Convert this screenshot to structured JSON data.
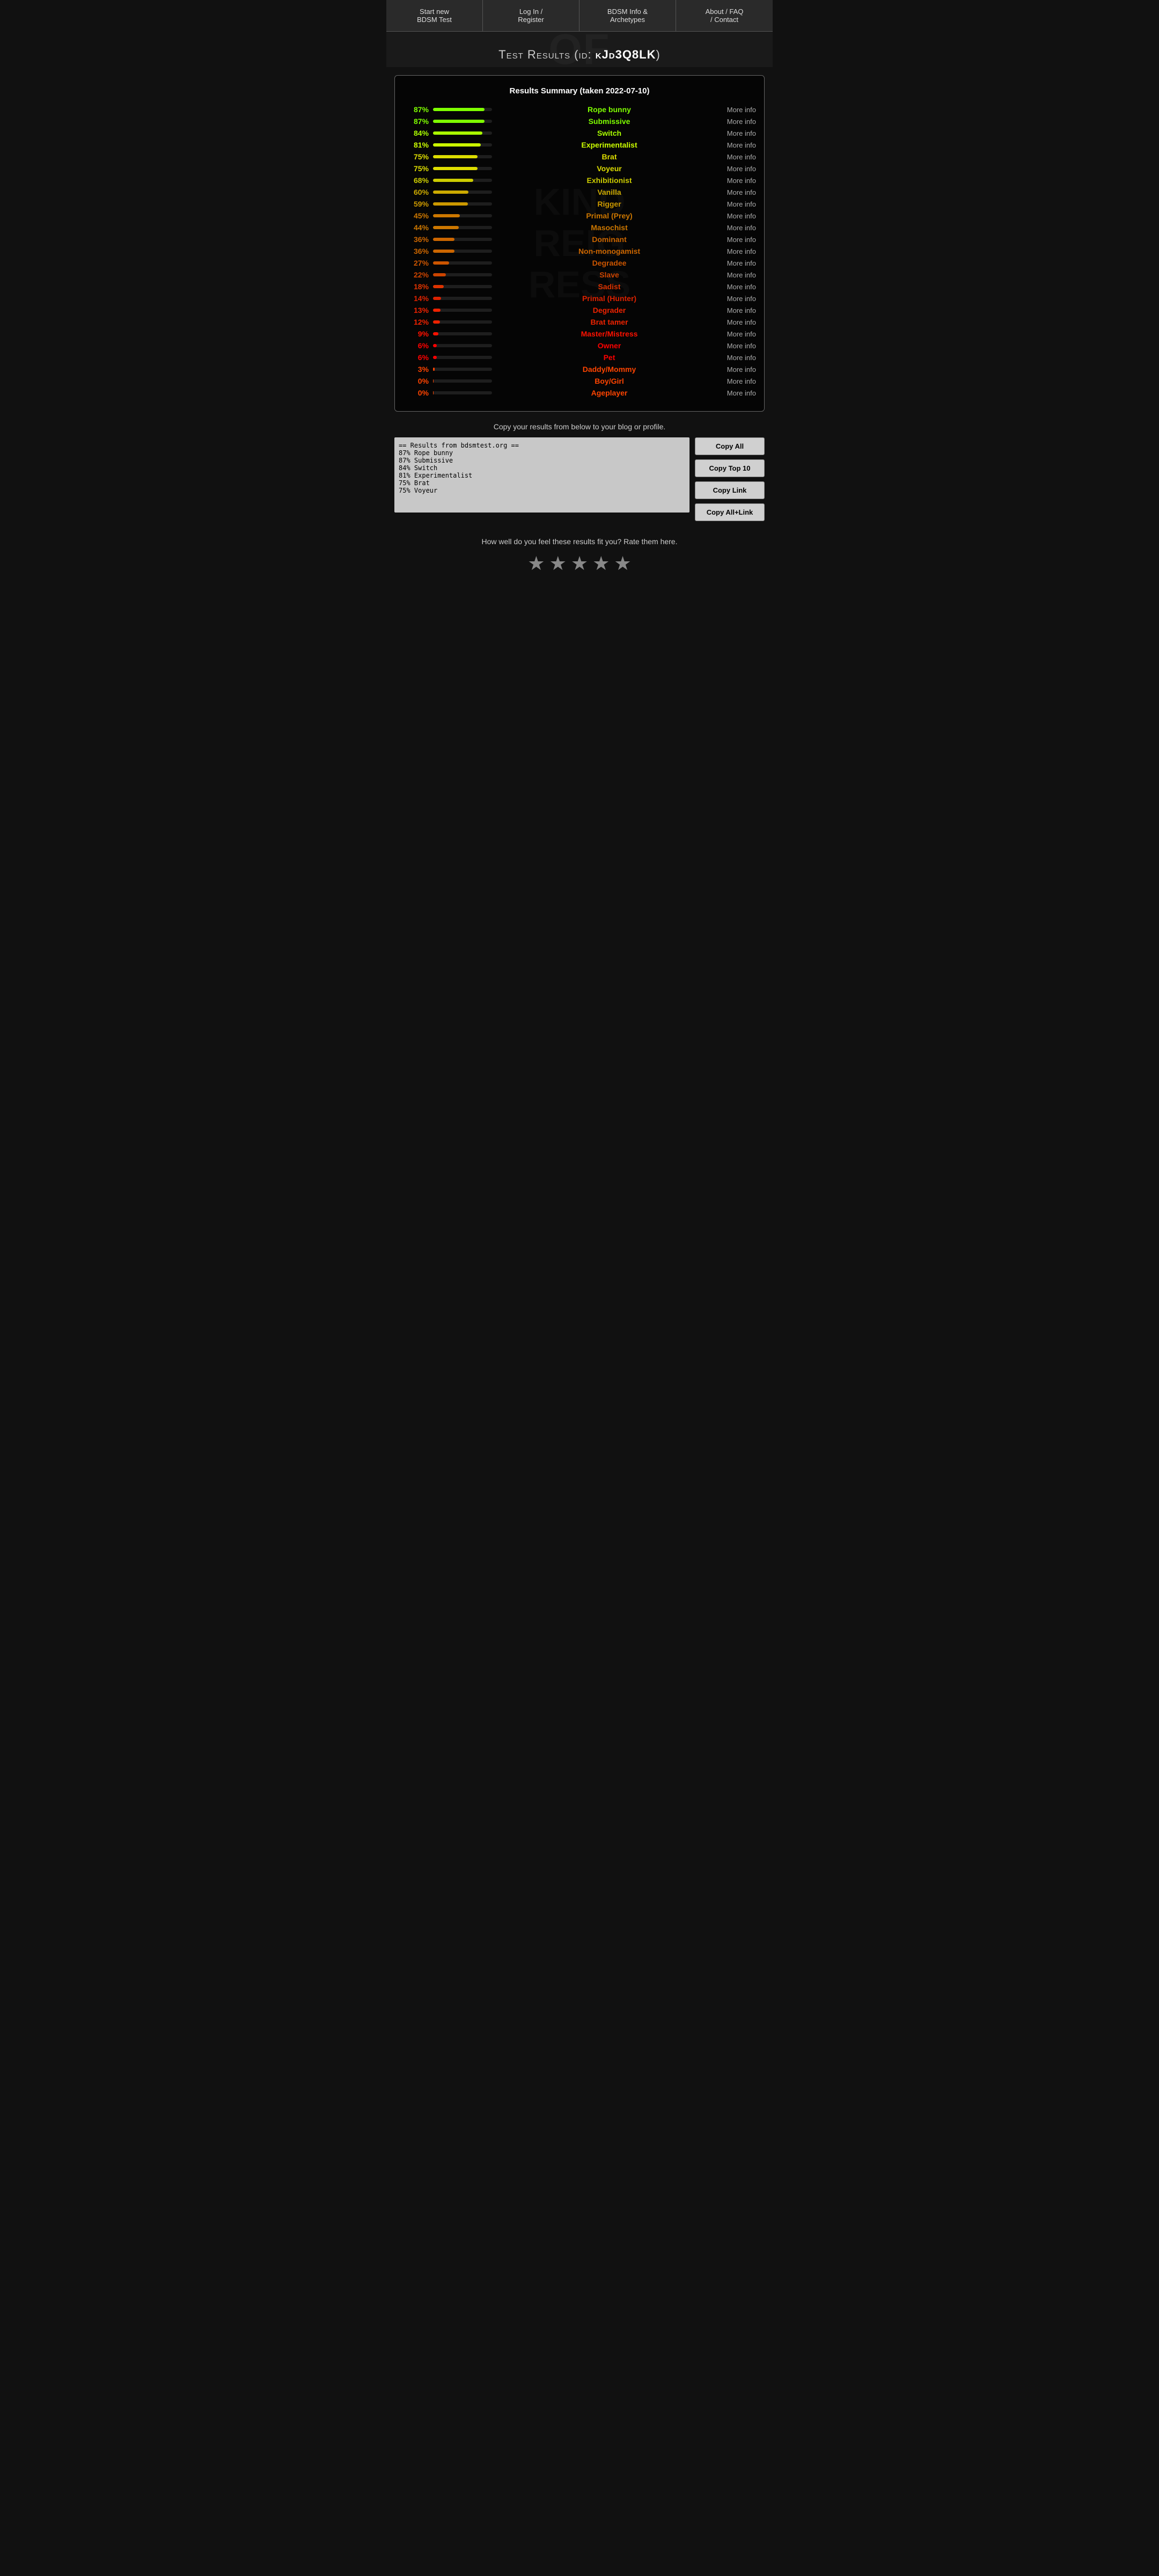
{
  "nav": {
    "items": [
      {
        "id": "start-test",
        "label": "Start new\nBDSM Test"
      },
      {
        "id": "login",
        "label": "Log In /\nRegister"
      },
      {
        "id": "info",
        "label": "BDSM Info &\nArchetypes"
      },
      {
        "id": "about",
        "label": "About / FAQ\n/ Contact"
      }
    ]
  },
  "hero": {
    "title_prefix": "Test Results (id: ",
    "test_id": "kJd3Q8LK",
    "title_suffix": ")"
  },
  "results": {
    "summary_title": "Results Summary (taken 2022-07-10)",
    "items": [
      {
        "pct": 87,
        "label": "Rope bunny",
        "color": "#7fff00"
      },
      {
        "pct": 87,
        "label": "Submissive",
        "color": "#7fff00"
      },
      {
        "pct": 84,
        "label": "Switch",
        "color": "#aaff00"
      },
      {
        "pct": 81,
        "label": "Experimentalist",
        "color": "#ccff00"
      },
      {
        "pct": 75,
        "label": "Brat",
        "color": "#dddd00"
      },
      {
        "pct": 75,
        "label": "Voyeur",
        "color": "#dddd00"
      },
      {
        "pct": 68,
        "label": "Exhibitionist",
        "color": "#cccc00"
      },
      {
        "pct": 60,
        "label": "Vanilla",
        "color": "#ccaa00"
      },
      {
        "pct": 59,
        "label": "Rigger",
        "color": "#cc9900"
      },
      {
        "pct": 45,
        "label": "Primal (Prey)",
        "color": "#cc7700"
      },
      {
        "pct": 44,
        "label": "Masochist",
        "color": "#cc7700"
      },
      {
        "pct": 36,
        "label": "Dominant",
        "color": "#cc6600"
      },
      {
        "pct": 36,
        "label": "Non-monogamist",
        "color": "#cc6600"
      },
      {
        "pct": 27,
        "label": "Degradee",
        "color": "#cc5500"
      },
      {
        "pct": 22,
        "label": "Slave",
        "color": "#cc4400"
      },
      {
        "pct": 18,
        "label": "Sadist",
        "color": "#dd3300"
      },
      {
        "pct": 14,
        "label": "Primal (Hunter)",
        "color": "#dd2200"
      },
      {
        "pct": 13,
        "label": "Degrader",
        "color": "#ee2200"
      },
      {
        "pct": 12,
        "label": "Brat tamer",
        "color": "#ee2200"
      },
      {
        "pct": 9,
        "label": "Master/Mistress",
        "color": "#ff1100"
      },
      {
        "pct": 6,
        "label": "Owner",
        "color": "#ff0000"
      },
      {
        "pct": 6,
        "label": "Pet",
        "color": "#ff0000"
      },
      {
        "pct": 3,
        "label": "Daddy/Mommy",
        "color": "#ff4400"
      },
      {
        "pct": 0,
        "label": "Boy/Girl",
        "color": "#ff4400"
      },
      {
        "pct": 0,
        "label": "Ageplayer",
        "color": "#ff4400"
      }
    ],
    "more_info_label": "More info"
  },
  "copy_section": {
    "instruction": "Copy your results from below to your blog or profile.",
    "textarea_content": "== Results from bdsmtest.org ==\n87% Rope bunny\n87% Submissive\n84% Switch\n81% Experimentalist\n75% Brat\n75% Voyeur",
    "buttons": [
      {
        "id": "copy-all",
        "label": "Copy All"
      },
      {
        "id": "copy-top10",
        "label": "Copy Top 10"
      },
      {
        "id": "copy-link",
        "label": "Copy Link"
      },
      {
        "id": "copy-all-link",
        "label": "Copy All+Link"
      }
    ]
  },
  "rating_section": {
    "text": "How well do you feel these results fit you? Rate them here.",
    "stars": 5
  }
}
